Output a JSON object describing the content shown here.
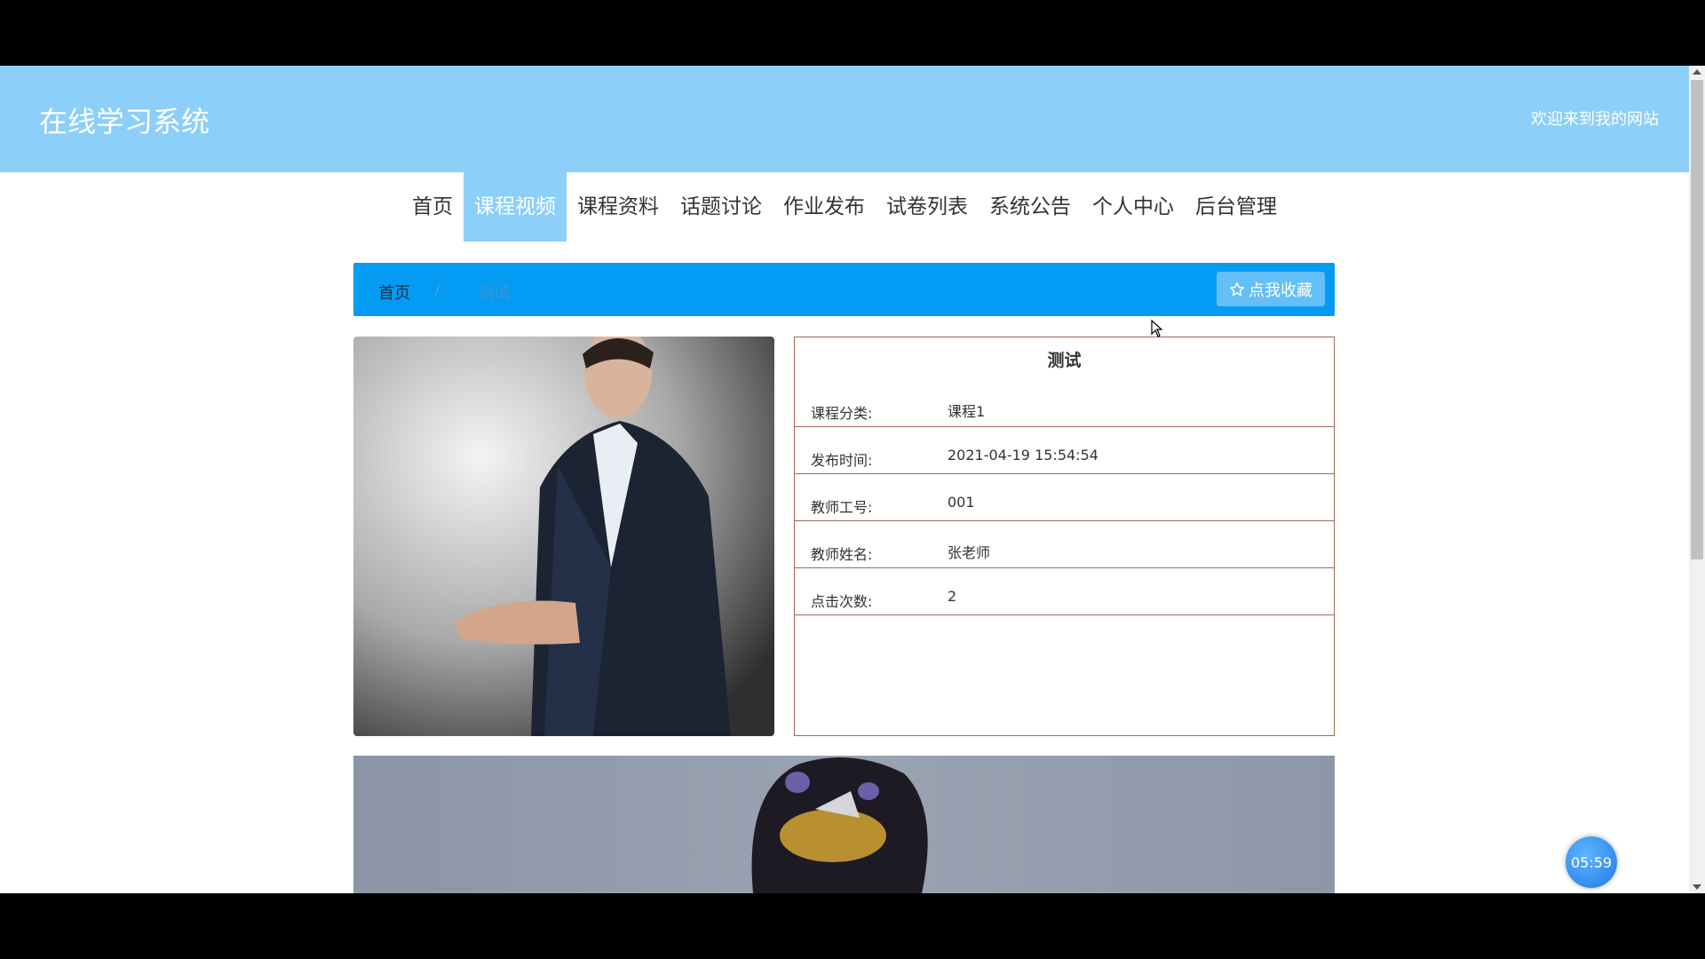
{
  "header": {
    "site_title": "在线学习系统",
    "welcome": "欢迎来到我的网站"
  },
  "nav": {
    "items": [
      "首页",
      "课程视频",
      "课程资料",
      "话题讨论",
      "作业发布",
      "试卷列表",
      "系统公告",
      "个人中心",
      "后台管理"
    ],
    "active_index": 1
  },
  "breadcrumb": {
    "home": "首页",
    "separator": "/",
    "current": "测试",
    "favorite_button": "点我收藏"
  },
  "course": {
    "title": "测试",
    "fields": [
      {
        "label": "课程分类:",
        "value": "课程1"
      },
      {
        "label": "发布时间:",
        "value": "2021-04-19 15:54:54"
      },
      {
        "label": "教师工号:",
        "value": "001"
      },
      {
        "label": "教师姓名:",
        "value": "张老师"
      },
      {
        "label": "点击次数:",
        "value": "2"
      }
    ]
  },
  "timer": "05:59",
  "colors": {
    "header_bg": "#8ccff8",
    "breadcrumb_bg": "#039bf3",
    "panel_border": "#a5655b"
  }
}
